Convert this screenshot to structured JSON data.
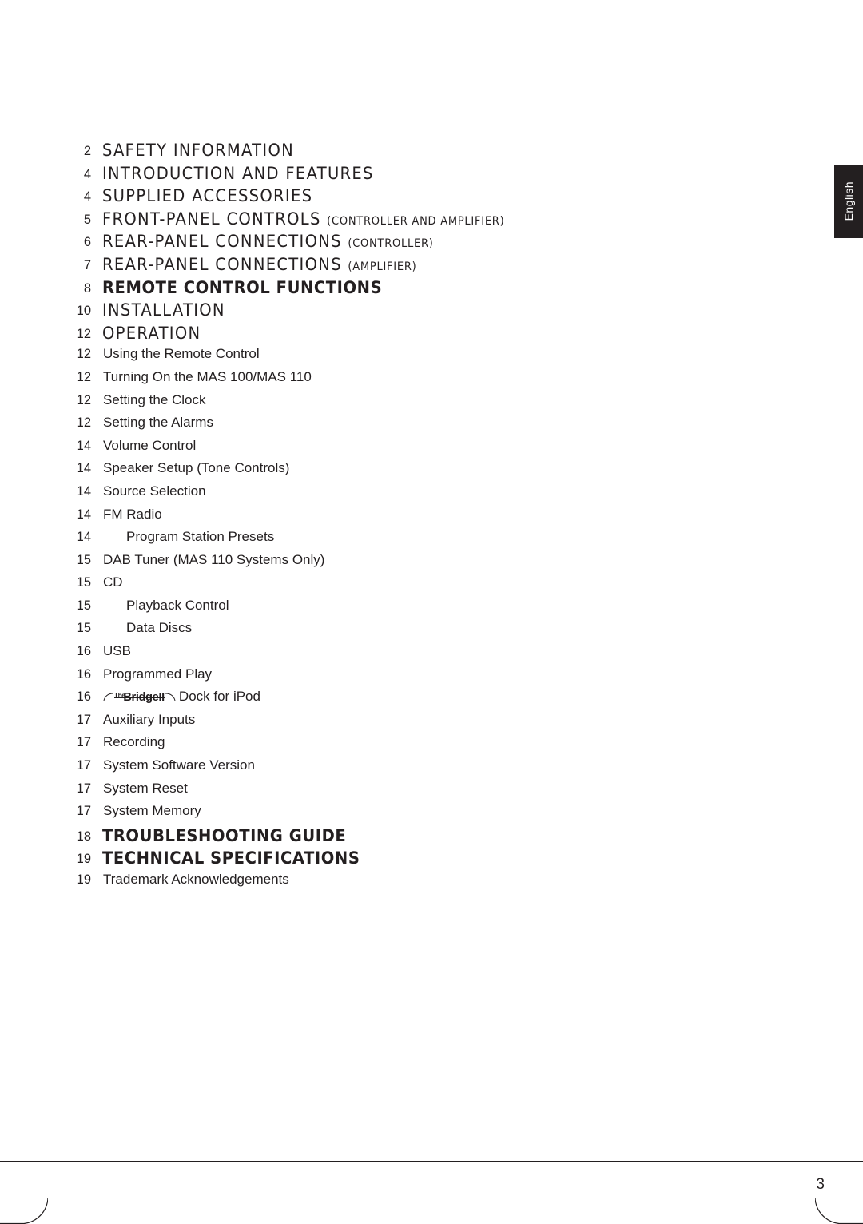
{
  "language_tab": {
    "label": "English"
  },
  "page_number": "3",
  "toc": {
    "entries": [
      {
        "page": "2",
        "title": "SAFETY  INFORMATION",
        "sub": "",
        "style": "head"
      },
      {
        "page": "4",
        "title": "INTRODUCTION  AND  FEATURES",
        "sub": "",
        "style": "head"
      },
      {
        "page": "4",
        "title": "SUPPLIED  ACCESSORIES",
        "sub": "",
        "style": "head"
      },
      {
        "page": "5",
        "title": "FRONT-PANEL  CONTROLS",
        "sub": "(CONTROLLER AND AMPLIFIER)",
        "style": "head"
      },
      {
        "page": "6",
        "title": "REAR-PANEL  CONNECTIONS",
        "sub": "(CONTROLLER)",
        "style": "head"
      },
      {
        "page": "7",
        "title": "REAR-PANEL  CONNECTIONS",
        "sub": "(AMPLIFIER)",
        "style": "head"
      },
      {
        "page": "8",
        "title": "REMOTE CONTROL  FUNCTIONS",
        "sub": "",
        "style": "head-bold"
      },
      {
        "page": "10",
        "title": "INSTALLATION",
        "sub": "",
        "style": "head"
      },
      {
        "page": "12",
        "title": "OPERATION",
        "sub": "",
        "style": "head"
      },
      {
        "page": "12",
        "title": "Using the Remote Control",
        "sub": "",
        "style": "item"
      },
      {
        "page": "12",
        "title": "Turning On the MAS 100/MAS 110",
        "sub": "",
        "style": "item"
      },
      {
        "page": "12",
        "title": "Setting the Clock",
        "sub": "",
        "style": "item"
      },
      {
        "page": "12",
        "title": "Setting the Alarms",
        "sub": "",
        "style": "item"
      },
      {
        "page": "14",
        "title": "Volume Control",
        "sub": "",
        "style": "item"
      },
      {
        "page": "14",
        "title": "Speaker Setup (Tone Controls)",
        "sub": "",
        "style": "item"
      },
      {
        "page": "14",
        "title": "Source Selection",
        "sub": "",
        "style": "item"
      },
      {
        "page": "14",
        "title": "FM Radio",
        "sub": "",
        "style": "item"
      },
      {
        "page": "14",
        "title": "Program Station Presets",
        "sub": "",
        "style": "item-indent"
      },
      {
        "page": "15",
        "title": "DAB Tuner (MAS 110 Systems Only)",
        "sub": "",
        "style": "item"
      },
      {
        "page": "15",
        "title": "CD",
        "sub": "",
        "style": "item"
      },
      {
        "page": "15",
        "title": "Playback Control",
        "sub": "",
        "style": "item-indent"
      },
      {
        "page": "15",
        "title": "Data Discs",
        "sub": "",
        "style": "item-indent"
      },
      {
        "page": "16",
        "title": "USB",
        "sub": "",
        "style": "item"
      },
      {
        "page": "16",
        "title": "Programmed Play",
        "sub": "",
        "style": "item"
      },
      {
        "page": "16",
        "title": "Dock for iPod",
        "sub": "",
        "style": "item-bridge",
        "logo": {
          "the": "The",
          "word": "Bridge",
          "suffix": "II"
        }
      },
      {
        "page": "17",
        "title": "Auxiliary Inputs",
        "sub": "",
        "style": "item"
      },
      {
        "page": "17",
        "title": "Recording",
        "sub": "",
        "style": "item"
      },
      {
        "page": "17",
        "title": "System Software Version",
        "sub": "",
        "style": "item"
      },
      {
        "page": "17",
        "title": "System Reset",
        "sub": "",
        "style": "item"
      },
      {
        "page": "17",
        "title": "System Memory",
        "sub": "",
        "style": "item"
      },
      {
        "page": "18",
        "title": "TROUBLESHOOTING GUIDE",
        "sub": "",
        "style": "head-bold"
      },
      {
        "page": "19",
        "title": "TECHNICAL SPECIFICATIONS",
        "sub": "",
        "style": "head-bold"
      },
      {
        "page": "19",
        "title": "Trademark Acknowledgements",
        "sub": "",
        "style": "item"
      }
    ]
  }
}
